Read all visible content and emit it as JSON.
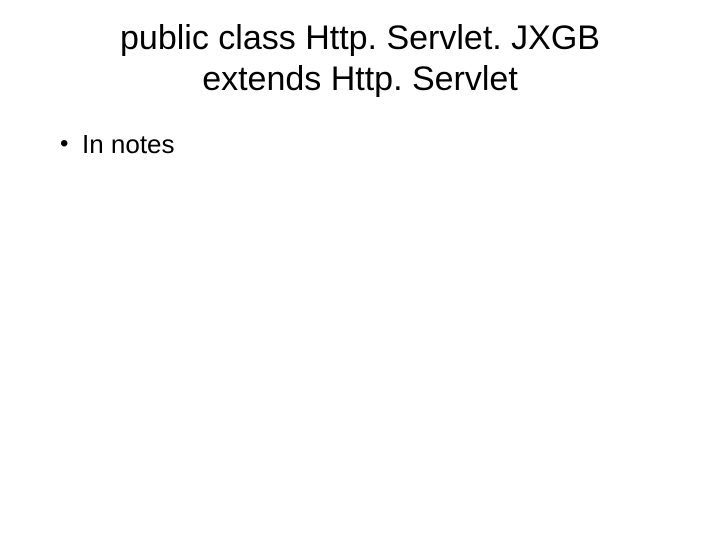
{
  "title_line1": "public class Http. Servlet. JXGB",
  "title_line2": "extends Http. Servlet",
  "bullets": [
    {
      "text": "In notes"
    }
  ]
}
